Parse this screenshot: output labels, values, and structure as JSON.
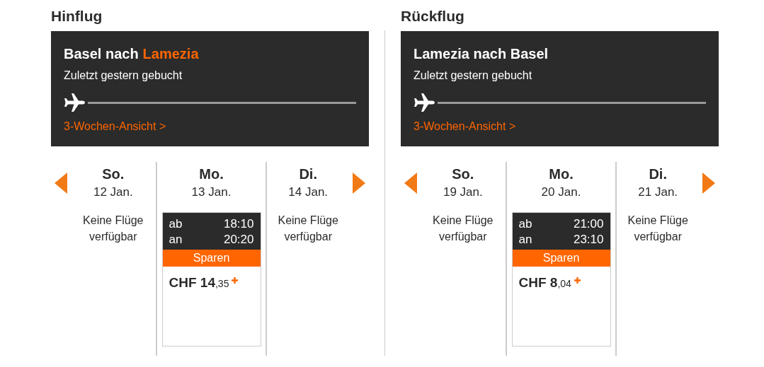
{
  "legs": [
    {
      "heading": "Hinflug",
      "route": [
        {
          "text": "Basel nach",
          "highlight": false
        },
        {
          "text": "Lamezia",
          "highlight": true
        }
      ],
      "note": "Zuletzt gestern gebucht",
      "link": "3-Wochen-Ansicht >",
      "days": [
        {
          "kind": "none",
          "weekday": "So.",
          "date": "12 Jan.",
          "message": "Keine Flüge verfügbar"
        },
        {
          "kind": "flight",
          "weekday": "Mo.",
          "date": "13 Jan.",
          "dep_label": "ab",
          "dep_time": "18:10",
          "arr_label": "an",
          "arr_time": "20:20",
          "fare": "Sparen",
          "price_main": "CHF 14",
          "price_cents": ",35"
        },
        {
          "kind": "none",
          "weekday": "Di.",
          "date": "14 Jan.",
          "message": "Keine Flüge verfügbar"
        }
      ]
    },
    {
      "heading": "Rückflug",
      "route": [
        {
          "text": "Lamezia nach Basel",
          "highlight": false
        }
      ],
      "note": "Zuletzt gestern gebucht",
      "link": "3-Wochen-Ansicht >",
      "days": [
        {
          "kind": "none",
          "weekday": "So.",
          "date": "19 Jan.",
          "message": "Keine Flüge verfügbar"
        },
        {
          "kind": "flight",
          "weekday": "Mo.",
          "date": "20 Jan.",
          "dep_label": "ab",
          "dep_time": "21:00",
          "arr_label": "an",
          "arr_time": "23:10",
          "fare": "Sparen",
          "price_main": "CHF 8",
          "price_cents": ",04"
        },
        {
          "kind": "none",
          "weekday": "Di.",
          "date": "21 Jan.",
          "message": "Keine Flüge verfügbar"
        }
      ]
    }
  ]
}
